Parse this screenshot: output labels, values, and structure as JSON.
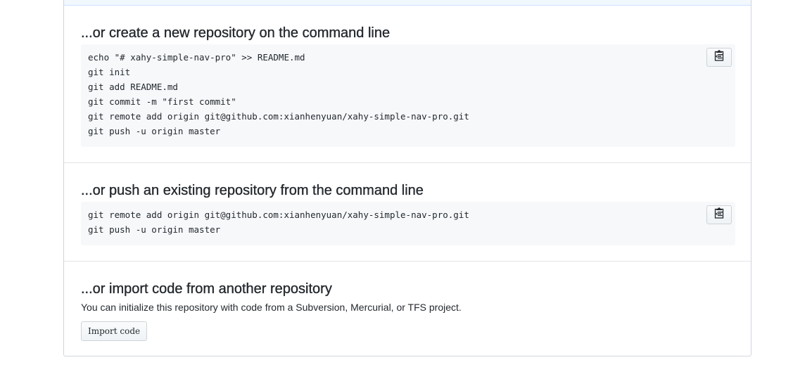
{
  "sections": {
    "create": {
      "title": "...or create a new repository on the command line",
      "lines": [
        "echo \"# xahy-simple-nav-pro\" >> README.md",
        "git init",
        "git add README.md",
        "git commit -m \"first commit\"",
        "git remote add origin git@github.com:xianhenyuan/xahy-simple-nav-pro.git",
        "git push -u origin master"
      ],
      "copy_icon": "clippy-icon"
    },
    "push": {
      "title": "...or push an existing repository from the command line",
      "lines": [
        "git remote add origin git@github.com:xianhenyuan/xahy-simple-nav-pro.git",
        "git push -u origin master"
      ],
      "copy_icon": "clippy-icon"
    },
    "import": {
      "title": "...or import code from another repository",
      "description": "You can initialize this repository with code from a Subversion, Mercurial, or TFS project.",
      "button_label": "Import code"
    }
  },
  "colors": {
    "code_background": "#f6f8fa",
    "border": "#d1d5da",
    "text": "#24292e",
    "top_strip": "#f1f8ff"
  }
}
